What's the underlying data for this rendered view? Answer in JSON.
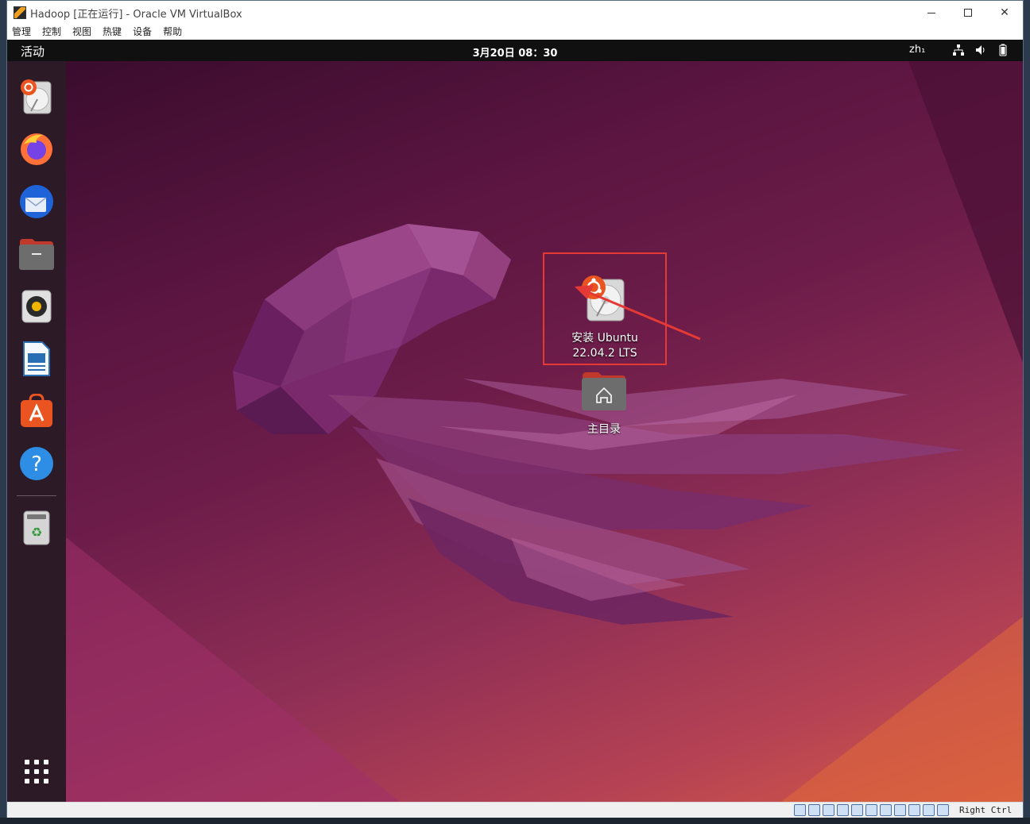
{
  "window": {
    "title": "Hadoop [正在运行] - Oracle VM VirtualBox"
  },
  "menu": {
    "items": [
      "管理",
      "控制",
      "视图",
      "热键",
      "设备",
      "帮助"
    ]
  },
  "top_panel": {
    "activities": "活动",
    "clock": "3月20日 08：30",
    "language": "zh₁",
    "tray_icons": [
      "network-icon",
      "volume-icon",
      "battery-icon"
    ]
  },
  "dock": {
    "items": [
      {
        "name": "dock-install-ubuntu",
        "icon": "installer-icon"
      },
      {
        "name": "dock-firefox",
        "icon": "firefox-icon"
      },
      {
        "name": "dock-thunderbird",
        "icon": "thunderbird-icon"
      },
      {
        "name": "dock-files",
        "icon": "files-icon"
      },
      {
        "name": "dock-rhythmbox",
        "icon": "rhythmbox-icon"
      },
      {
        "name": "dock-writer",
        "icon": "libreoffice-writer-icon"
      },
      {
        "name": "dock-software",
        "icon": "app-center-icon"
      },
      {
        "name": "dock-help",
        "icon": "help-icon"
      },
      {
        "name": "dock-trash",
        "icon": "trash-icon"
      }
    ]
  },
  "desktop": {
    "install_label_line1": "安装 Ubuntu",
    "install_label_line2": "22.04.2 LTS",
    "home_label": "主目录"
  },
  "statusbar": {
    "host_key": "Right Ctrl"
  },
  "colors": {
    "highlight_box": "#e53935",
    "ubuntu_orange": "#e95420",
    "dock_bg": "#2c1a26"
  }
}
